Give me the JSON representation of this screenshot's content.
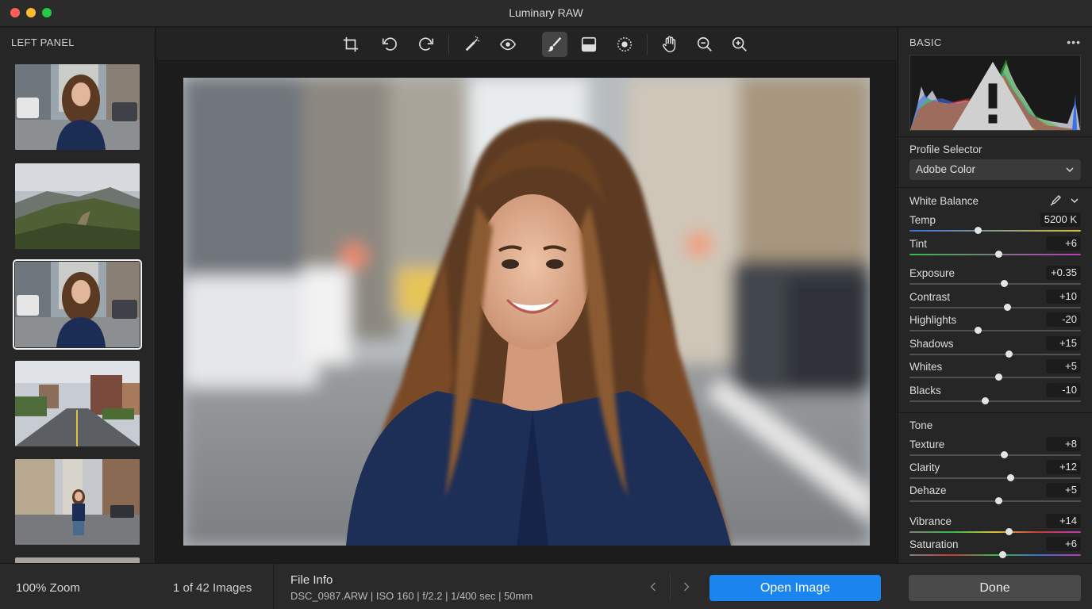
{
  "window": {
    "title": "Luminary RAW"
  },
  "left_panel": {
    "title": "LEFT PANEL",
    "thumbnails": [
      {
        "subject": "woman-street-portrait"
      },
      {
        "subject": "mountain-landscape"
      },
      {
        "subject": "woman-street-portrait",
        "selected": true
      },
      {
        "subject": "city-avenue"
      },
      {
        "subject": "woman-standing-street"
      }
    ]
  },
  "toolbar": {
    "tools": [
      {
        "name": "crop-icon"
      },
      {
        "name": "rotate-left-icon"
      },
      {
        "name": "rotate-right-icon"
      },
      {
        "name": "healing-brush-icon"
      },
      {
        "name": "red-eye-icon"
      },
      {
        "name": "brush-icon",
        "active": true
      },
      {
        "name": "linear-gradient-icon"
      },
      {
        "name": "radial-filter-icon"
      },
      {
        "name": "hand-icon"
      },
      {
        "name": "zoom-out-icon"
      },
      {
        "name": "zoom-in-icon"
      }
    ]
  },
  "right_panel": {
    "title": "BASIC",
    "more_icon": "more-horizontal-icon",
    "histogram": {
      "warning_icon": "clipping-warning-icon",
      "colors": [
        "#d83a3a",
        "#3fbf3f",
        "#3a6fe8",
        "#e0d030",
        "#cfd4e0"
      ]
    },
    "profile": {
      "label": "Profile Selector",
      "value": "Adobe Color"
    },
    "white_balance": {
      "label": "White Balance",
      "sliders": [
        {
          "label": "Temp",
          "value": "5200 K",
          "position": 0.4,
          "gradient": [
            "#3b6fd8",
            "#d8c23b"
          ]
        },
        {
          "label": "Tint",
          "value": "+6",
          "position": 0.52,
          "gradient": [
            "#3bb84a",
            "#b83bb8"
          ]
        }
      ]
    },
    "basic_sliders": [
      {
        "label": "Exposure",
        "value": "+0.35",
        "position": 0.55
      },
      {
        "label": "Contrast",
        "value": "+10",
        "position": 0.57
      },
      {
        "label": "Highlights",
        "value": "-20",
        "position": 0.4
      },
      {
        "label": "Shadows",
        "value": "+15",
        "position": 0.58
      },
      {
        "label": "Whites",
        "value": "+5",
        "position": 0.52
      },
      {
        "label": "Blacks",
        "value": "-10",
        "position": 0.44
      }
    ],
    "tone": {
      "label": "Tone",
      "sliders": [
        {
          "label": "Texture",
          "value": "+8",
          "position": 0.55
        },
        {
          "label": "Clarity",
          "value": "+12",
          "position": 0.59
        },
        {
          "label": "Dehaze",
          "value": "+5",
          "position": 0.52
        }
      ]
    },
    "presence": [
      {
        "label": "Vibrance",
        "value": "+14",
        "position": 0.58,
        "gradient": [
          "#808080",
          "#3bb84a",
          "#d8c23b",
          "#c83b3b",
          "#b83bb8"
        ]
      },
      {
        "label": "Saturation",
        "value": "+6",
        "position": 0.54,
        "gradient": [
          "#808080",
          "#c83b3b",
          "#3bb84a",
          "#3b6fd8",
          "#b83bb8"
        ]
      }
    ]
  },
  "bottom_bar": {
    "zoom": "100% Zoom",
    "image_count": "1 of 42 Images",
    "file_info_title": "File Info",
    "file_info_meta": "DSC_0987.ARW | ISO 160 | f/2.2 | 1/400 sec | 50mm",
    "open_button": "Open Image",
    "done_button": "Done",
    "accent": "#1a85ee"
  }
}
